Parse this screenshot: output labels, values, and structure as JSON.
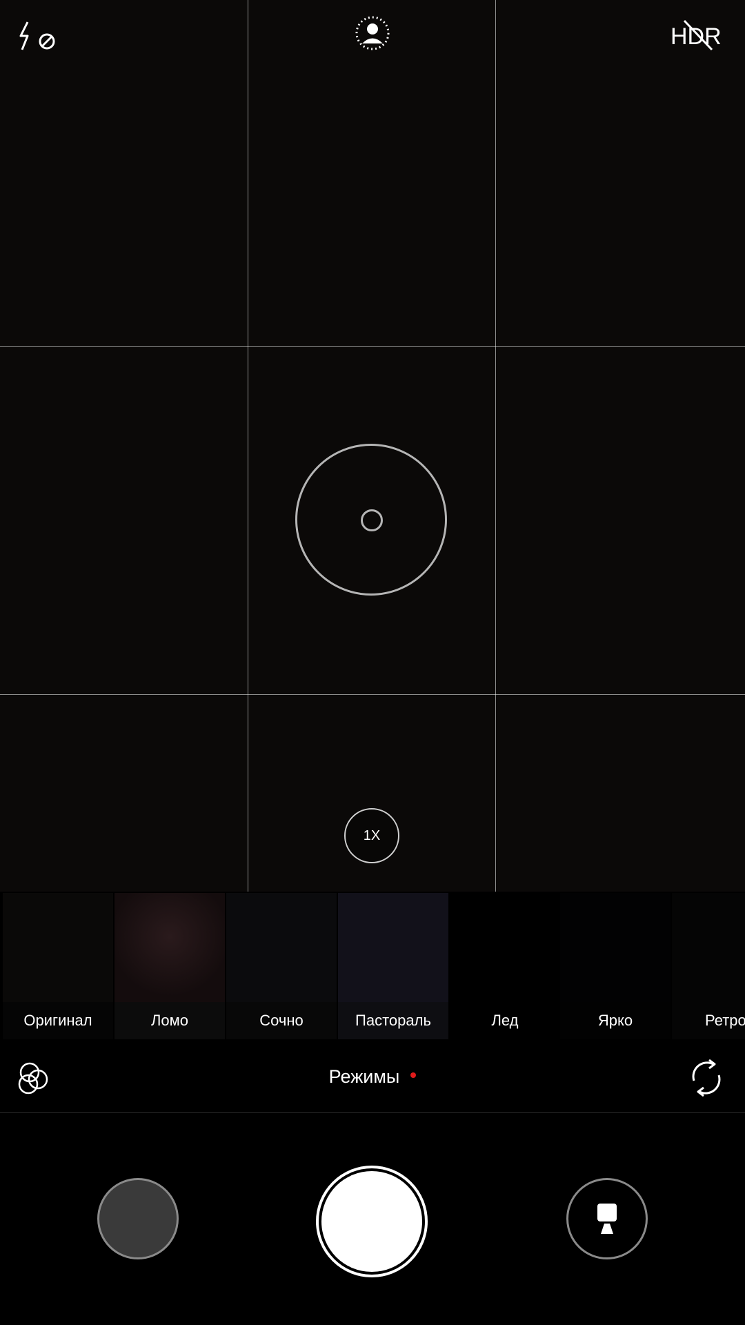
{
  "top_bar": {
    "flash_icon": "flash-off-icon",
    "portrait_icon": "portrait-mode-icon",
    "hdr_label": "HDR"
  },
  "viewfinder": {
    "zoom_label": "1X"
  },
  "filters": [
    {
      "label": "Оригинал",
      "selected": true
    },
    {
      "label": "Ломо",
      "selected": false
    },
    {
      "label": "Сочно",
      "selected": false
    },
    {
      "label": "Пастораль",
      "selected": false
    },
    {
      "label": "Лед",
      "selected": false
    },
    {
      "label": "Ярко",
      "selected": false
    },
    {
      "label": "Ретро",
      "selected": false
    }
  ],
  "modes_bar": {
    "filters_icon": "filters-icon",
    "label": "Режимы",
    "switch_camera_icon": "switch-camera-icon"
  },
  "controls": {
    "gallery_icon": "gallery-thumbnail",
    "shutter_icon": "shutter-button",
    "mode_icon": "photo-video-toggle-icon"
  },
  "colors": {
    "selection_accent": "#1e9be8",
    "notification_dot": "#e01b1b"
  }
}
